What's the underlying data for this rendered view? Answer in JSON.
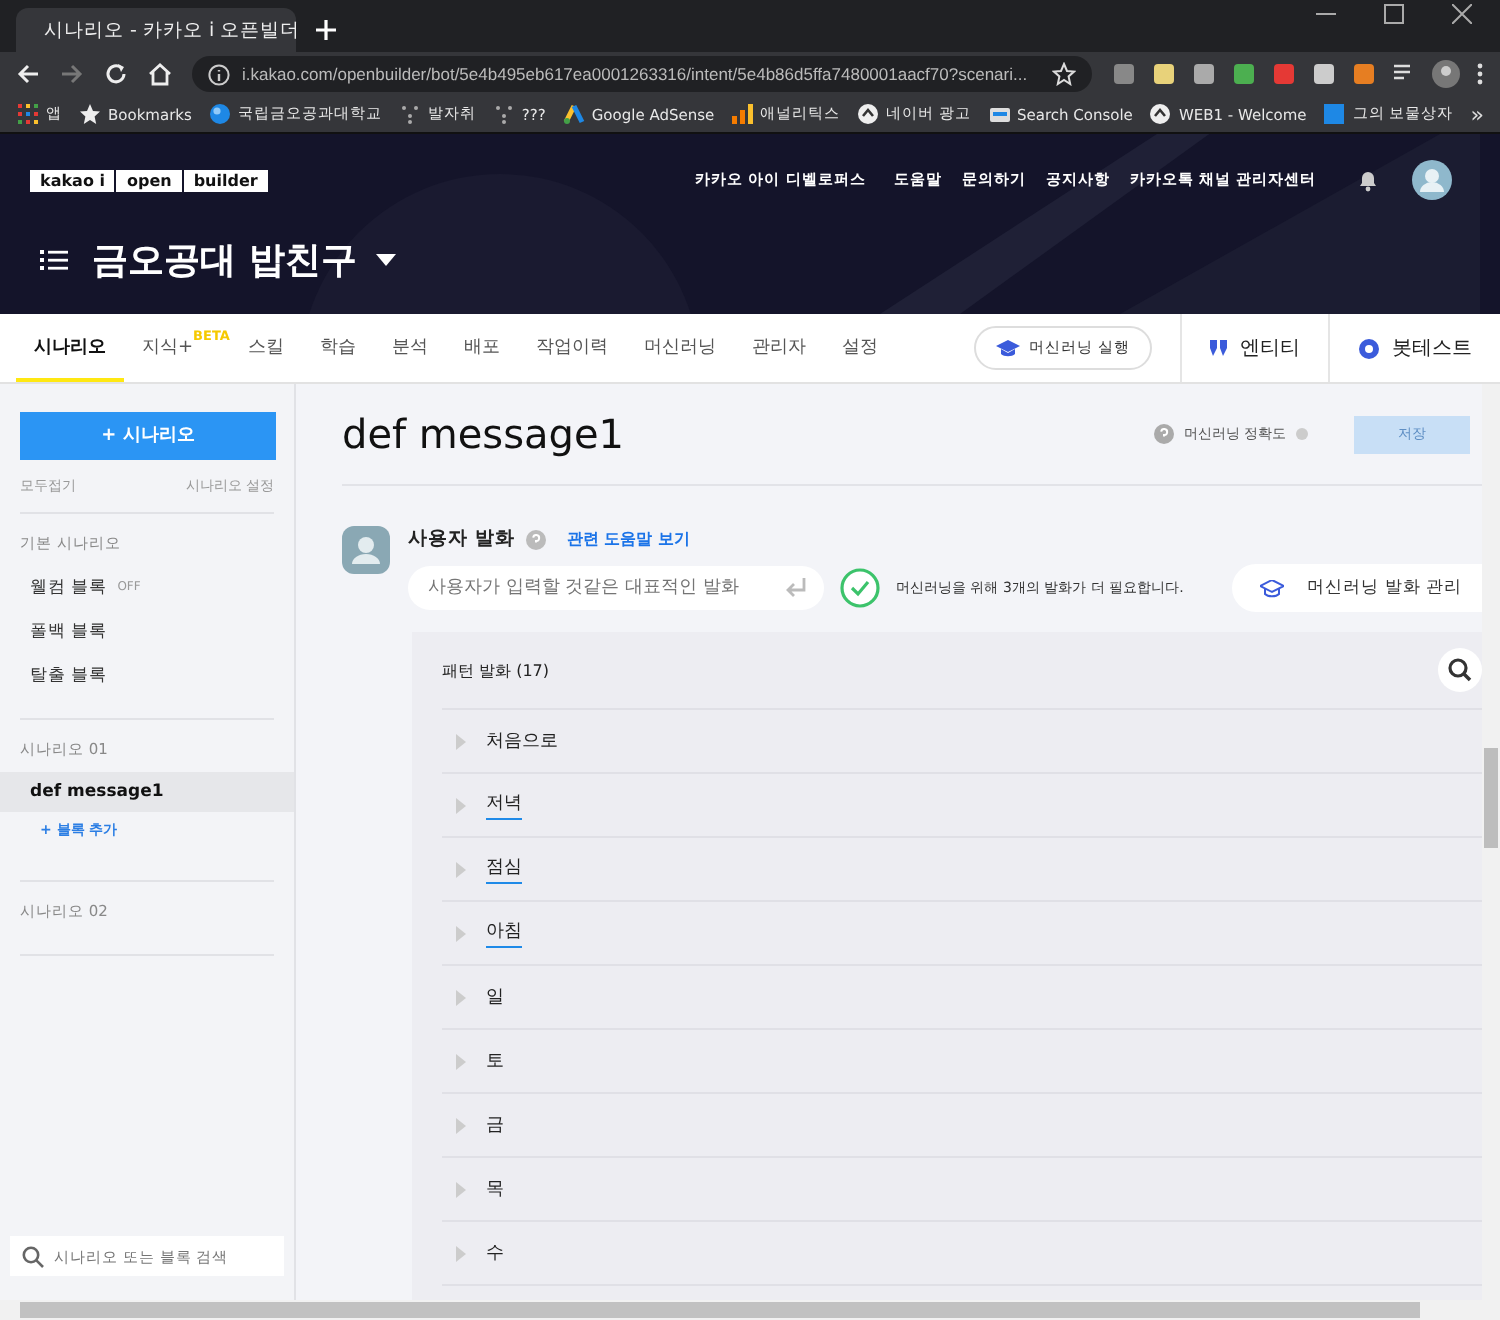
{
  "browser": {
    "tab_title": "시나리오 - 카카오 i 오픈빌더",
    "url": "i.kakao.com/openbuilder/bot/5e4b495eb617ea0001263316/intent/5e4b86d5ffa7480001aacf70?scenari...",
    "bookmarks": [
      {
        "label": "앱"
      },
      {
        "label": "Bookmarks"
      },
      {
        "label": "국립금오공과대학교"
      },
      {
        "label": "발자취"
      },
      {
        "label": "???"
      },
      {
        "label": "Google AdSense"
      },
      {
        "label": "애널리틱스"
      },
      {
        "label": "네이버 광고"
      },
      {
        "label": "Search Console"
      },
      {
        "label": "WEB1 - Welcome"
      },
      {
        "label": "그의 보물상자"
      }
    ],
    "more": "»"
  },
  "header": {
    "logo": [
      "kakao i",
      "open",
      "builder"
    ],
    "links": [
      "카카오 아이 디벨로퍼스",
      "도움말",
      "문의하기",
      "공지사항",
      "카카오톡 채널 관리자센터"
    ],
    "bot_name": "금오공대 밥친구"
  },
  "tabs": [
    {
      "label": "시나리오",
      "selected": true
    },
    {
      "label": "지식+",
      "selected": false,
      "badge": "BETA"
    },
    {
      "label": "스킬",
      "selected": false
    },
    {
      "label": "학습",
      "selected": false
    },
    {
      "label": "분석",
      "selected": false
    },
    {
      "label": "배포",
      "selected": false
    },
    {
      "label": "작업이력",
      "selected": false
    },
    {
      "label": "머신러닝",
      "selected": false
    },
    {
      "label": "관리자",
      "selected": false
    },
    {
      "label": "설정",
      "selected": false
    }
  ],
  "ml_run_button": "머신러닝 실행",
  "entity_button": "엔티티",
  "bot_test_button": "봇테스트",
  "sidebar": {
    "add_button": "+ 시나리오",
    "collapse_all": "모두접기",
    "settings": "시나리오 설정",
    "groups": [
      {
        "title": "기본 시나리오",
        "blocks": [
          {
            "label": "웰컴 블록",
            "selected": false,
            "badge": "OFF"
          },
          {
            "label": "폴백 블록",
            "selected": false
          },
          {
            "label": "탈출 블록",
            "selected": false
          }
        ]
      },
      {
        "title": "시나리오 01",
        "blocks": [
          {
            "label": "def message1",
            "selected": true
          }
        ],
        "add_block": "+ 블록 추가"
      },
      {
        "title": "시나리오 02"
      }
    ],
    "search_placeholder": "시나리오 또는 블록 검색"
  },
  "main": {
    "title": "def message1",
    "accuracy_label": "머신러닝 정확도",
    "save_button": {
      "label": "저장",
      "disabled": true
    },
    "section_title": "사용자 발화",
    "help_link": "관련 도움말 보기",
    "input_placeholder": "사용자가 입력할 것같은 대표적인 발화",
    "ml_notice": "머신러닝을 위해 3개의 발화가 더 필요합니다.",
    "ml_manage_button": "머신러닝 발화 관리",
    "pattern_title": "패턴 발화 (17)",
    "utterances": [
      {
        "text": "처음으로",
        "annotated": false
      },
      {
        "text": "저녁",
        "annotated": true
      },
      {
        "text": "점심",
        "annotated": true
      },
      {
        "text": "아침",
        "annotated": true
      },
      {
        "text": "일",
        "annotated": false
      },
      {
        "text": "토",
        "annotated": false
      },
      {
        "text": "금",
        "annotated": false
      },
      {
        "text": "목",
        "annotated": false
      },
      {
        "text": "수",
        "annotated": false
      }
    ]
  }
}
